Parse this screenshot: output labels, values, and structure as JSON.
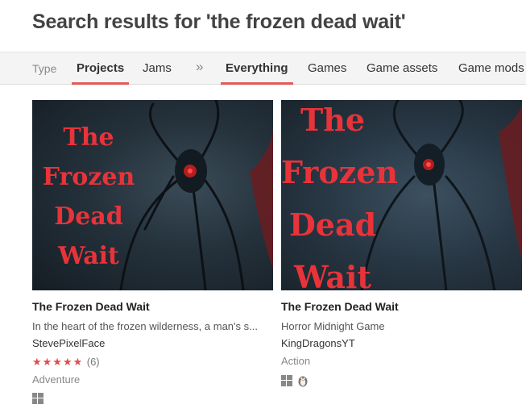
{
  "page": {
    "title": "Search results for 'the frozen dead wait'"
  },
  "filters": {
    "type_label": "Type",
    "items": [
      "Projects",
      "Jams",
      "»",
      "Everything",
      "Games",
      "Game assets",
      "Game mods"
    ]
  },
  "accent_color": "#e05a5a",
  "results": [
    {
      "cover_text": [
        "The",
        "Frozen",
        "Dead",
        "Wait"
      ],
      "title": "The Frozen Dead Wait",
      "description": "In the heart of the frozen wilderness, a man's s...",
      "author": "StevePixelFace",
      "rating_stars": "★★★★★",
      "rating_value": 5,
      "rating_count": "(6)",
      "genre": "Adventure",
      "platforms": [
        "windows-icon"
      ]
    },
    {
      "cover_text": [
        "The",
        "Frozen",
        "Dead",
        "Wait"
      ],
      "title": "The Frozen Dead Wait",
      "description": "Horror Midnight Game",
      "author": "KingDragonsYT",
      "genre": "Action",
      "platforms": [
        "windows-icon",
        "linux-icon"
      ]
    }
  ]
}
